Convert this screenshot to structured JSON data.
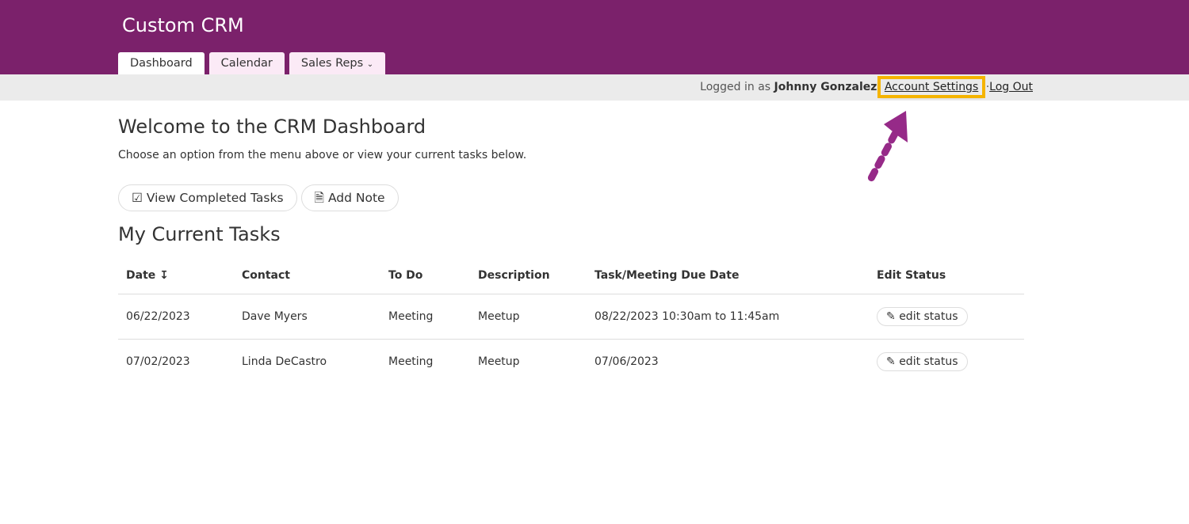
{
  "app": {
    "title": "Custom CRM"
  },
  "tabs": [
    {
      "label": "Dashboard"
    },
    {
      "label": "Calendar"
    },
    {
      "label": "Sales Reps"
    }
  ],
  "userbar": {
    "prefix": "Logged in as",
    "user": "Johnny Gonzalez",
    "account_settings": "Account Settings",
    "separator": "·",
    "logout": "Log Out"
  },
  "main": {
    "title": "Welcome to the CRM Dashboard",
    "subtitle": "Choose an option from the menu above or view your current tasks below.",
    "view_completed": "View Completed Tasks",
    "add_note": "Add Note",
    "tasks_title": "My Current Tasks"
  },
  "table": {
    "headers": [
      "Date",
      "Contact",
      "To Do",
      "Description",
      "Task/Meeting Due Date",
      "Edit Status"
    ],
    "rows": [
      {
        "date": "06/22/2023",
        "contact": "Dave Myers",
        "todo": "Meeting",
        "desc": "Meetup",
        "due": "08/22/2023 10:30am to 11:45am",
        "action": "edit status"
      },
      {
        "date": "07/02/2023",
        "contact": "Linda DeCastro",
        "todo": "Meeting",
        "desc": "Meetup",
        "due": "07/06/2023",
        "action": "edit status"
      }
    ]
  },
  "colors": {
    "brand": "#7b216b",
    "highlight": "#f5b400"
  }
}
